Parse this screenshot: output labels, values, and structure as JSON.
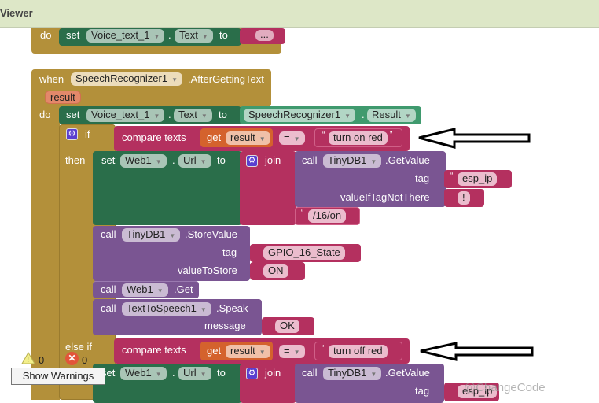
{
  "header": {
    "title": "Viewer"
  },
  "block1": {
    "do": "do",
    "set": "set",
    "component": "Voice_text_1",
    "property": "Text",
    "to": "to",
    "value": "..."
  },
  "event": {
    "when": "when",
    "component": "SpeechRecognizer1",
    "event": ".AfterGettingText",
    "param": "result",
    "do": "do"
  },
  "set_text": {
    "set": "set",
    "component": "Voice_text_1",
    "property": "Text",
    "to": "to",
    "getter_component": "SpeechRecognizer1",
    "getter_property": "Result"
  },
  "if1": {
    "if": "if",
    "then": "then",
    "compare": "compare texts",
    "get": "get",
    "var": "result",
    "op": "=",
    "value": "turn on red"
  },
  "set_url1": {
    "set": "set",
    "component": "Web1",
    "property": "Url",
    "to": "to",
    "join": "join",
    "call": "call",
    "db": "TinyDB1",
    "method": ".GetValue",
    "tag_label": "tag",
    "tag": "esp_ip",
    "default_label": "valueIfTagNotThere",
    "default": "!",
    "suffix": "/16/on"
  },
  "store": {
    "call": "call",
    "db": "TinyDB1",
    "method": ".StoreValue",
    "tag_label": "tag",
    "tag": "GPIO_16_State",
    "value_label": "valueToStore",
    "value": "ON"
  },
  "web_get": {
    "call": "call",
    "component": "Web1",
    "method": ".Get"
  },
  "speak": {
    "call": "call",
    "component": "TextToSpeech1",
    "method": ".Speak",
    "message_label": "message",
    "message": "OK"
  },
  "elseif": {
    "label": "else if",
    "compare": "compare texts",
    "get": "get",
    "var": "result",
    "op": "=",
    "value": "turn off red"
  },
  "set_url2": {
    "set": "set",
    "component": "Web1",
    "property": "Url",
    "to": "to",
    "join": "join",
    "call": "call",
    "db": "TinyDB1",
    "method": ".GetValue",
    "tag_label": "tag",
    "tag": "esp_ip"
  },
  "status": {
    "warnings": "0",
    "errors": "0",
    "show_warnings": "Show Warnings"
  },
  "watermark": "@ChangeCode",
  "colors": {
    "control": "#b3903a",
    "setter": "#2a6e4a",
    "text": "#b4305f",
    "procedure": "#7a5592",
    "variable": "#d4622d"
  }
}
